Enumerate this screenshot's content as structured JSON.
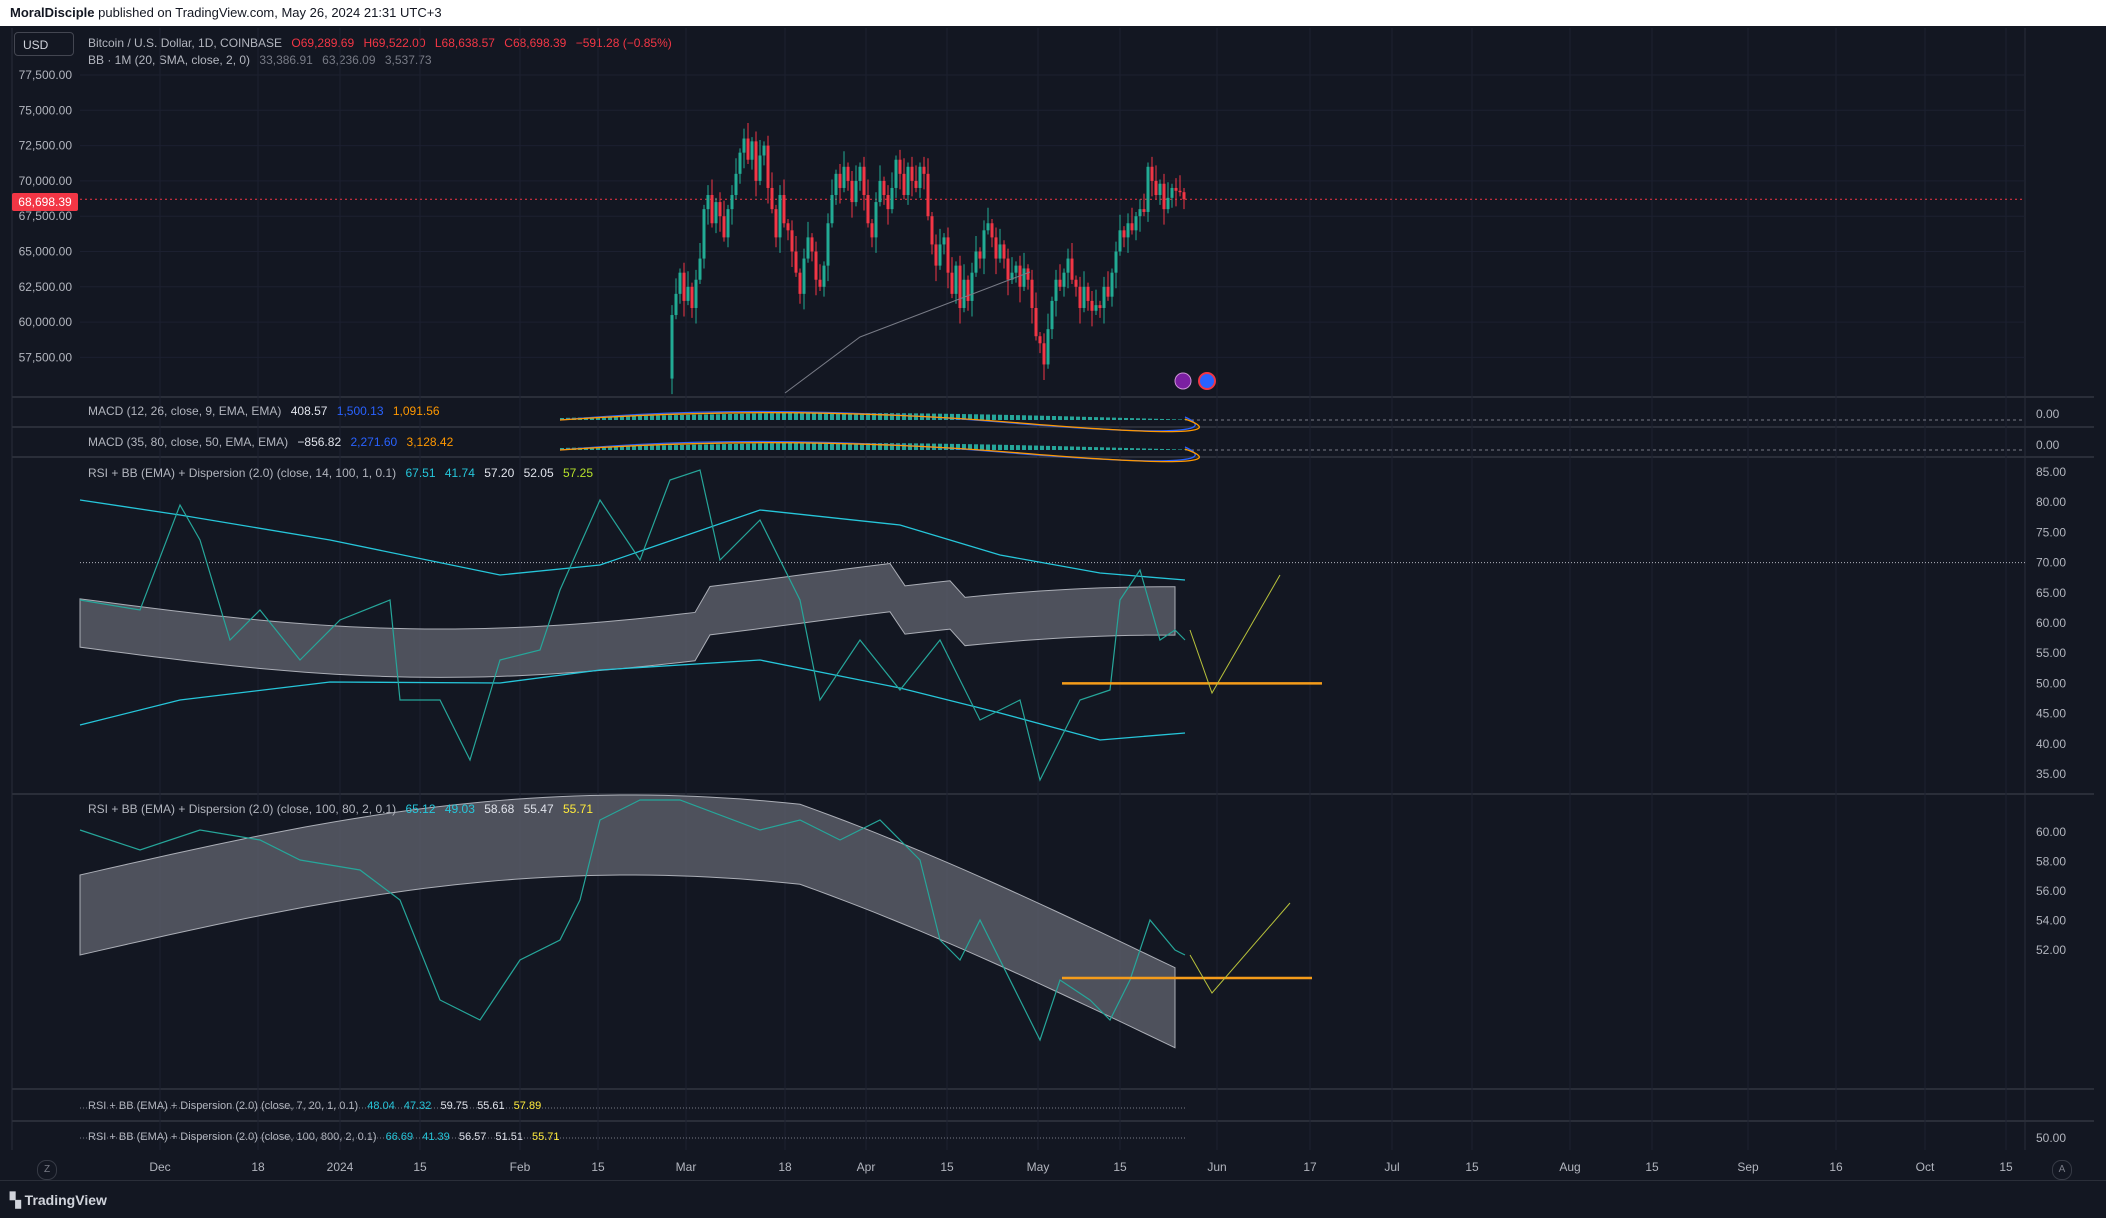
{
  "header": {
    "author": "MoralDisciple",
    "published": "published on TradingView.com, May 26, 2024 21:31 UTC+3"
  },
  "currency_button": "USD",
  "main_legend": {
    "symbol": "Bitcoin / U.S. Dollar, 1D, COINBASE",
    "open": "O69,289.69",
    "high": "H69,522.00",
    "low": "L68,638.57",
    "close": "C68,698.39",
    "change": "−591.28 (−0.85%)"
  },
  "bb_legend": {
    "label": "BB · 1M (20, SMA, close, 2, 0)",
    "v1": "33,386.91",
    "v2": "63,236.09",
    "v3": "3,537.73"
  },
  "price_axis": [
    "77,500.00",
    "75,000.00",
    "72,500.00",
    "70,000.00",
    "67,500.00",
    "65,000.00",
    "62,500.00",
    "60,000.00",
    "57,500.00"
  ],
  "last_price": "68,698.39",
  "macd1": {
    "label": "MACD (12, 26, close, 9, EMA, EMA)",
    "v1": "408.57",
    "v2": "1,500.13",
    "v3": "1,091.56",
    "zero": "0.00"
  },
  "macd2": {
    "label": "MACD (35, 80, close, 50, EMA, EMA)",
    "v1": "−856.82",
    "v2": "2,271.60",
    "v3": "3,128.42",
    "zero": "0.00"
  },
  "rsi1": {
    "label": "RSI + BB (EMA) + Dispersion (2.0) (close, 14, 100, 1, 0.1)",
    "vals": [
      "67.51",
      "41.74",
      "57.20",
      "52.05",
      "57.25"
    ],
    "axis": [
      "85.00",
      "80.00",
      "75.00",
      "70.00",
      "65.00",
      "60.00",
      "55.00",
      "50.00",
      "45.00",
      "40.00",
      "35.00"
    ]
  },
  "rsi2": {
    "label": "RSI + BB (EMA) + Dispersion (2.0) (close, 100, 80, 2, 0.1)",
    "vals": [
      "65.12",
      "49.03",
      "58.68",
      "55.47",
      "55.71"
    ],
    "axis": [
      "60.00",
      "58.00",
      "56.00",
      "54.00",
      "52.00"
    ]
  },
  "rsi3": {
    "label": "RSI + BB (EMA) + Dispersion (2.0) (close, 7, 20, 1, 0.1)",
    "vals": [
      "48.04",
      "47.32",
      "59.75",
      "55.61",
      "57.89"
    ]
  },
  "rsi4": {
    "label": "RSI + BB (EMA) + Dispersion (2.0) (close, 100, 800, 2, 0.1)",
    "vals": [
      "66.69",
      "41.39",
      "56.57",
      "51.51",
      "55.71"
    ],
    "axis": "50.00"
  },
  "time_axis": [
    "Dec",
    "18",
    "2024",
    "15",
    "Feb",
    "15",
    "Mar",
    "18",
    "Apr",
    "15",
    "May",
    "15",
    "Jun",
    "17",
    "Jul",
    "15",
    "Aug",
    "15",
    "Sep",
    "16",
    "Oct",
    "15"
  ],
  "footer": {
    "logo": "TradingView"
  },
  "colors": {
    "up": "#22ab94",
    "down": "#f23645",
    "orange": "#f59c1a",
    "bg": "#131722"
  }
}
